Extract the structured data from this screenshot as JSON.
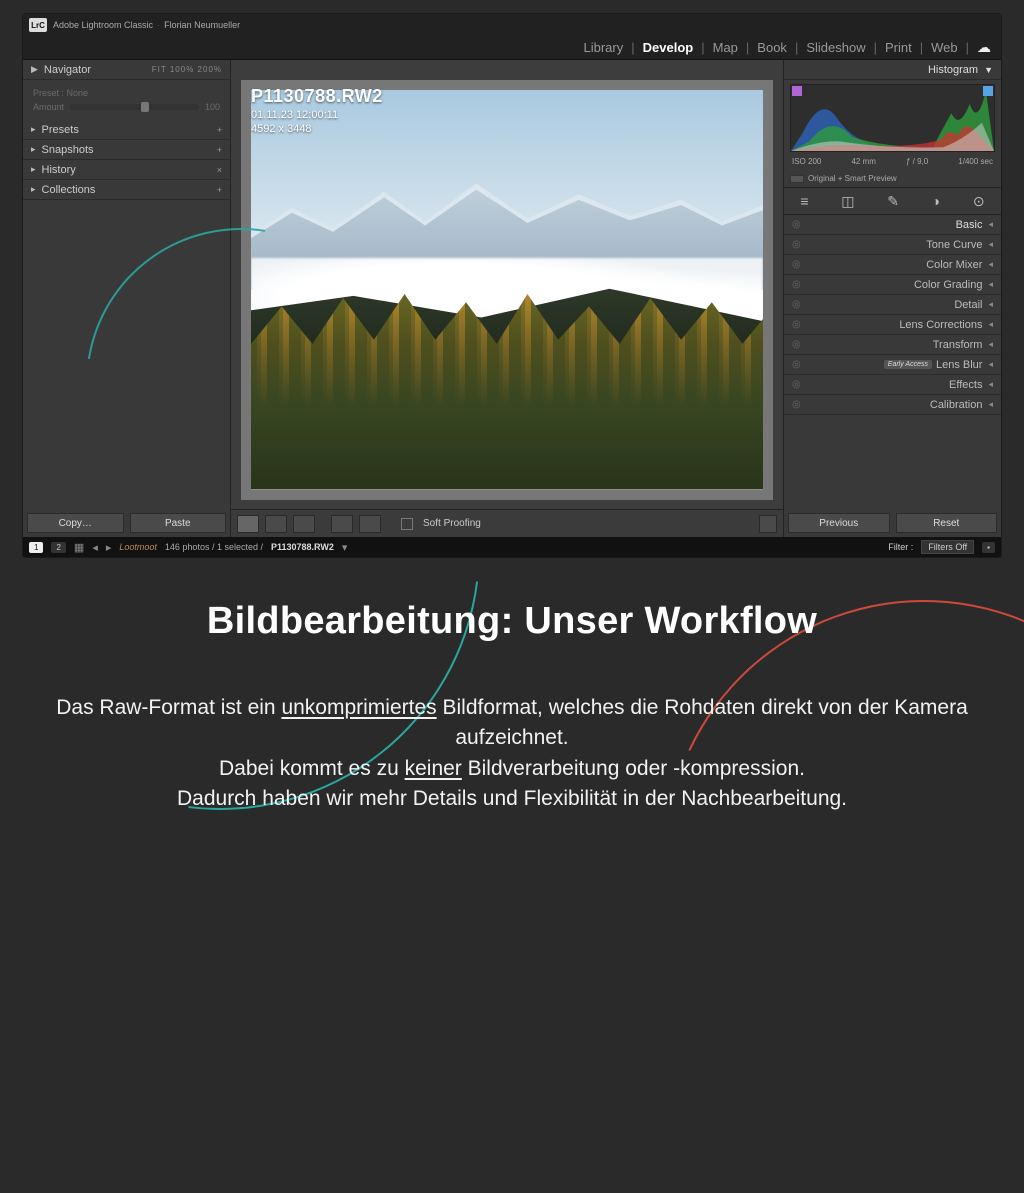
{
  "titlebar": {
    "app_name": "Adobe Lightroom Classic",
    "user_name": "Florian Neumueller",
    "logo": "LrC"
  },
  "menubar": {
    "items": [
      "Library",
      "Develop",
      "Map",
      "Book",
      "Slideshow",
      "Print",
      "Web"
    ],
    "active_index": 1,
    "cloud_icon": "cloud-icon"
  },
  "left": {
    "navigator": {
      "label": "Navigator",
      "modes": "FIT   100%   200%"
    },
    "preset_box": {
      "preset_label": "Preset : None",
      "amount_label": "Amount",
      "amount_value": "100"
    },
    "panels": [
      {
        "label": "Presets",
        "suffix": "+"
      },
      {
        "label": "Snapshots",
        "suffix": "+"
      },
      {
        "label": "History",
        "suffix": "×"
      },
      {
        "label": "Collections",
        "suffix": "+"
      }
    ],
    "copy_label": "Copy…",
    "paste_label": "Paste"
  },
  "center": {
    "filename": "P1130788.RW2",
    "datetime": "01.11.23 12:00:11",
    "dimensions": "4592 x 3448",
    "soft_proofing": "Soft Proofing"
  },
  "right": {
    "histogram_label": "Histogram",
    "meta": {
      "iso": "ISO 200",
      "focal": "42 mm",
      "aperture": "ƒ / 9,0",
      "shutter": "1/400 sec"
    },
    "preview_label": "Original + Smart Preview",
    "tools": [
      "sliders-icon",
      "crop-icon",
      "heal-icon",
      "mask-icon",
      "redeye-icon"
    ],
    "panels": [
      {
        "label": "Basic",
        "bold": true
      },
      {
        "label": "Tone Curve"
      },
      {
        "label": "Color Mixer"
      },
      {
        "label": "Color Grading"
      },
      {
        "label": "Detail"
      },
      {
        "label": "Lens Corrections"
      },
      {
        "label": "Transform"
      },
      {
        "label": "Lens Blur",
        "badge": "Early Access"
      },
      {
        "label": "Effects"
      },
      {
        "label": "Calibration"
      }
    ],
    "previous_label": "Previous",
    "reset_label": "Reset"
  },
  "statusbar": {
    "index1": "1",
    "index2": "2",
    "brand": "Lootmoot",
    "count_text": "146 photos / 1 selected /",
    "current_file": "P1130788.RW2",
    "filter_label": "Filter :",
    "filter_value": "Filters Off"
  },
  "article": {
    "title": "Bildbearbeitung: Unser Workflow",
    "p1a": "Das Raw-Format ist ein ",
    "p1u": "unkomprimiertes",
    "p1b": " Bildformat, welches die Rohdaten direkt von der Kamera aufzeichnet.",
    "p2a": "Dabei kommt es zu ",
    "p2u": "keiner",
    "p2b": " Bildverarbeitung oder -kompression.",
    "p3": "Dadurch haben wir mehr Details und Flexibilität in der Nachbearbeitung."
  }
}
